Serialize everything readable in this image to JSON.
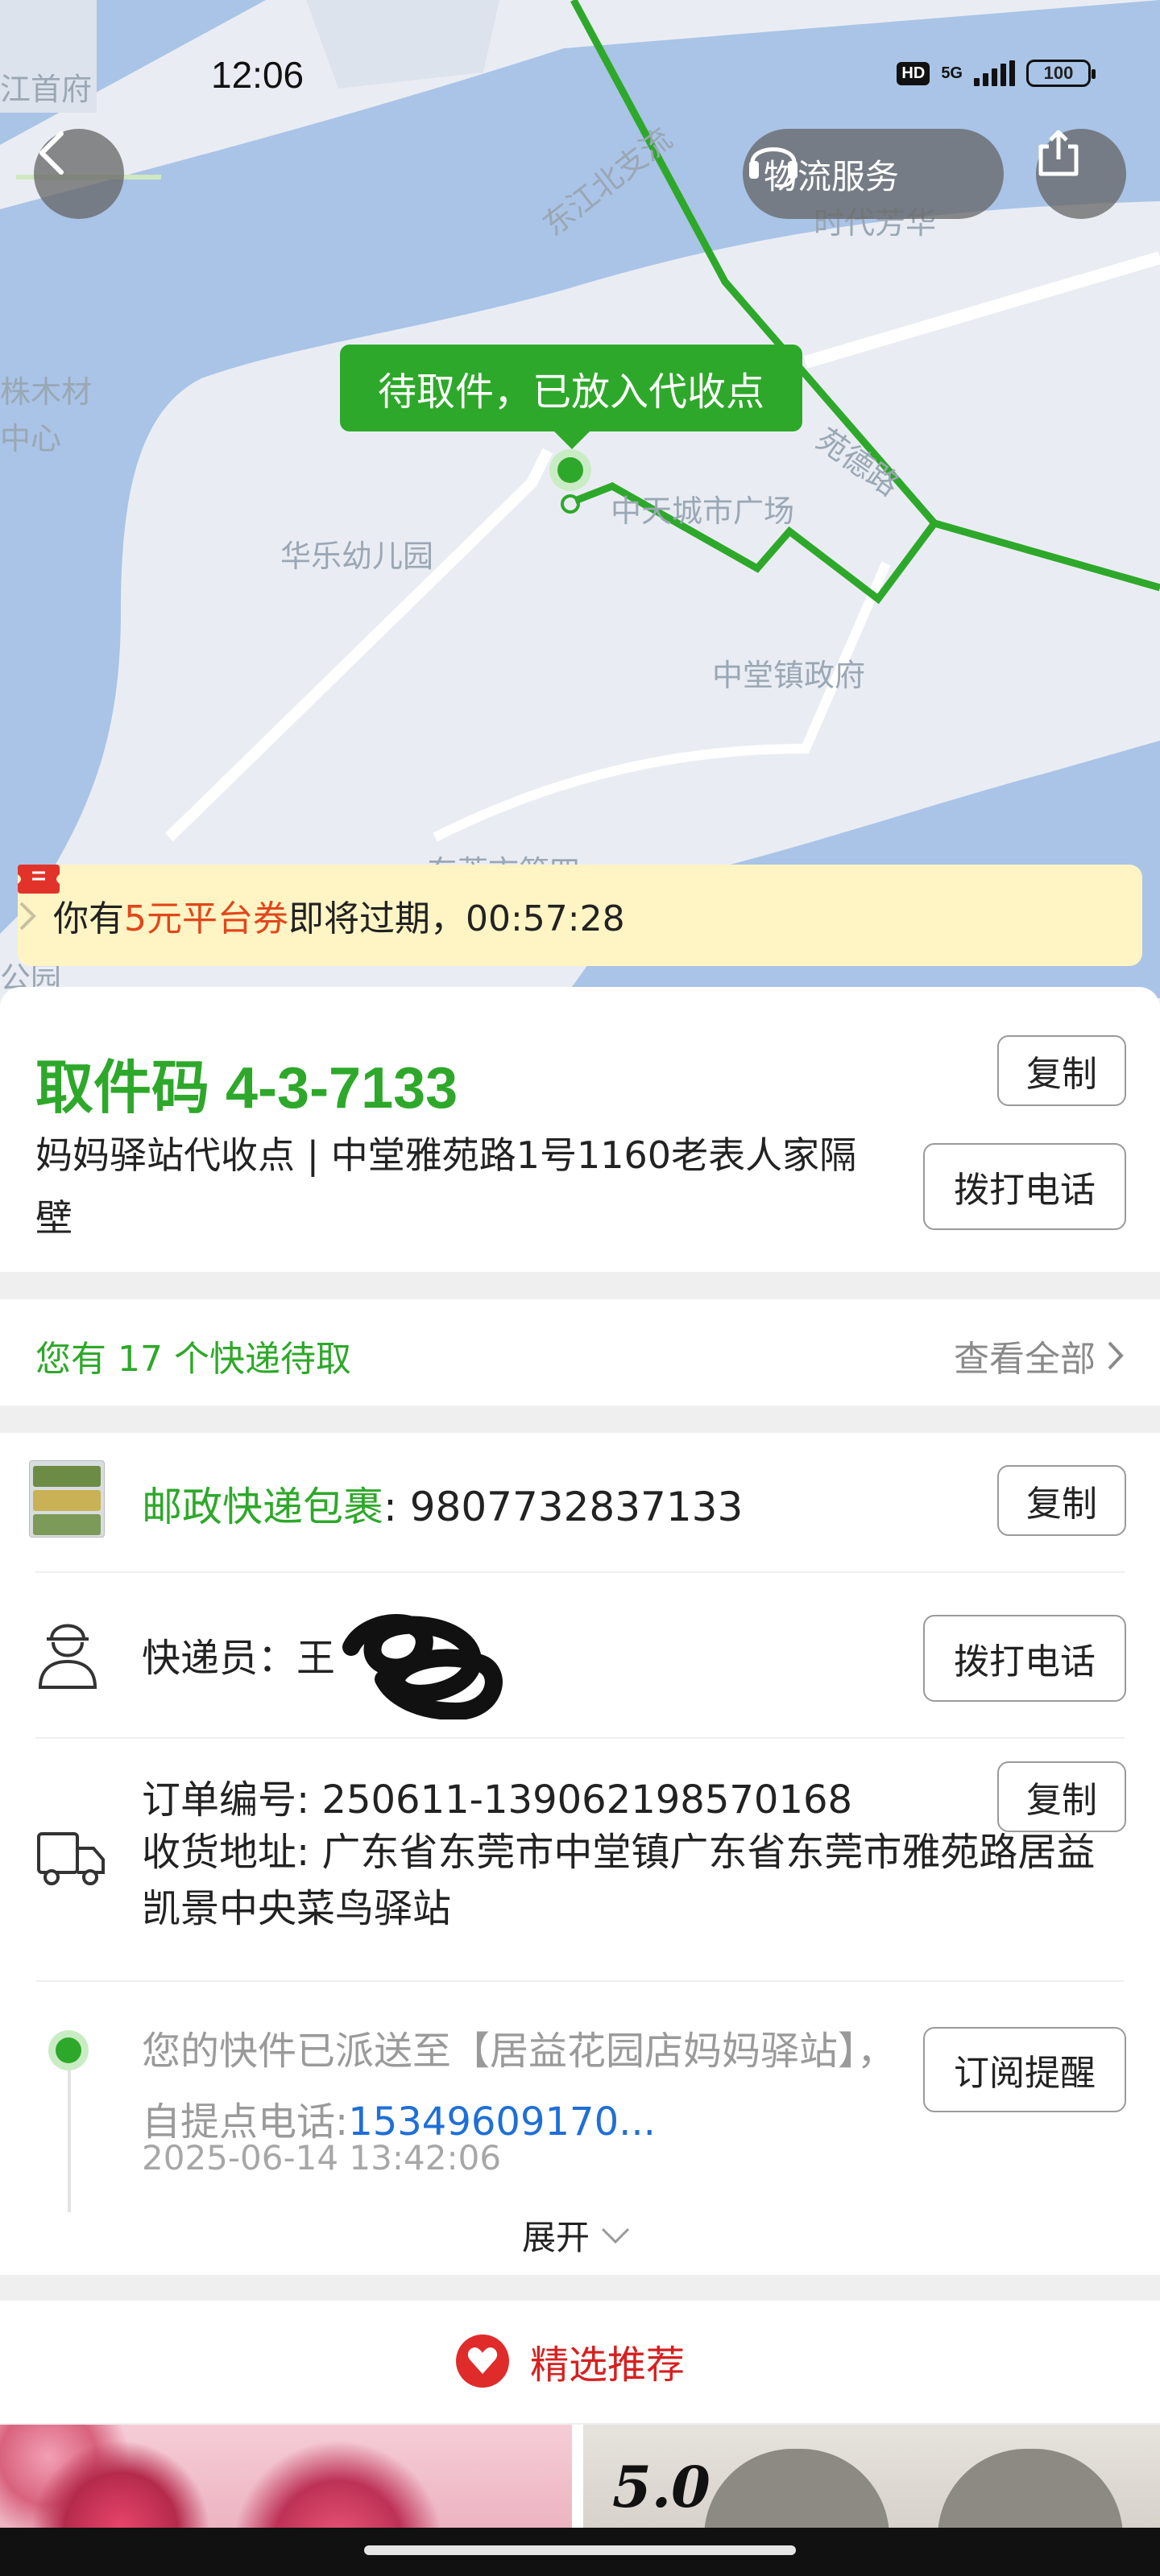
{
  "status_bar": {
    "time": "12:06",
    "hd": "HD",
    "network": "5G",
    "battery": "100"
  },
  "map": {
    "labels": {
      "river_north": "东江北支流",
      "county_gov": "江首府",
      "timber_center_1": "株木材",
      "timber_center_2": "中心",
      "times_fangua": "时代芳华",
      "yayuan_road": "苑德路",
      "mall": "中天城市广场",
      "kindergarten": "华乐幼儿园",
      "town_gov": "中堂镇政府",
      "park_cut": "东莞市第四",
      "park_left": "公园"
    },
    "status_bubble": "待取件，已放入代收点"
  },
  "nav": {
    "back_icon": "chevron-left-icon",
    "logistics_label": "物流服务",
    "share_icon": "share-icon"
  },
  "coupon": {
    "prefix": "你有",
    "highlight": "5元平台券",
    "suffix": "即将过期，00:57:28"
  },
  "pickup": {
    "code_label": "取件码 4-3-7133",
    "copy_label": "复制",
    "address": "妈妈驿站代收点 | 中堂雅苑路1号1160老表人家隔壁",
    "call_label": "拨打电话"
  },
  "pending": {
    "text": "您有 17 个快递待取",
    "view_all": "查看全部"
  },
  "package": {
    "carrier": "邮政快递包裹",
    "tracking_number": ": 9807732837133",
    "copy_label": "复制",
    "courier_label": "快递员：",
    "courier_name": "王",
    "call_label": "拨打电话",
    "order_number": "订单编号: 250611-139062198570168",
    "order_copy_label": "复制",
    "address_label": "收货地址: 广东省东莞市中堂镇广东省东莞市雅苑路居益凯景中央菜鸟驿站"
  },
  "tracking": {
    "text_prefix": "您的快件已派送至【居益花园店妈妈驿站】，自提点电话:",
    "phone": "15349609170...",
    "time": "2025-06-14 13:42:06",
    "subscribe_label": "订阅提醒",
    "expand_label": "展开"
  },
  "recommend": {
    "label": "精选推荐"
  },
  "products": {
    "score": "5.0"
  },
  "colors": {
    "brand_green": "#2ea82a",
    "coupon_bg": "#fff4c4",
    "coupon_highlight": "#e0471b",
    "link_blue": "#1f6fd6",
    "recommend_red": "#d62020"
  }
}
